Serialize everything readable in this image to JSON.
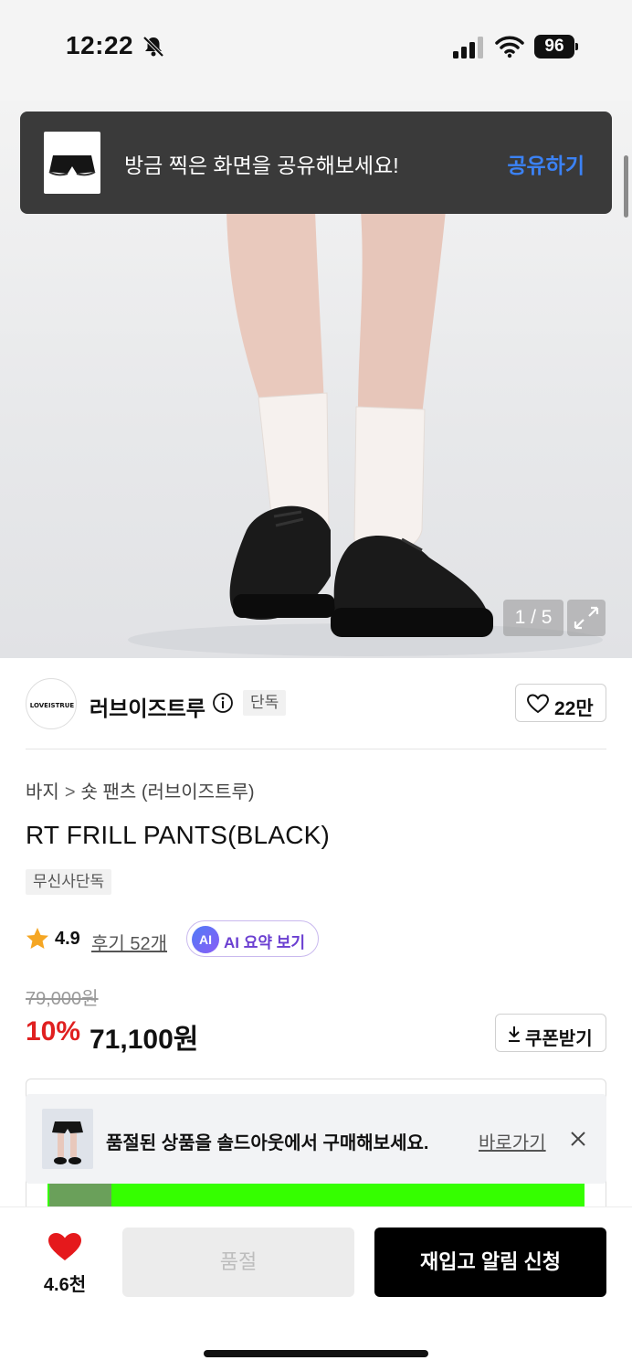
{
  "status_bar": {
    "time": "12:22",
    "battery": "96"
  },
  "share_toast": {
    "message": "방금 찍은 화면을 공유해보세요!",
    "action": "공유하기"
  },
  "gallery": {
    "counter": "1 / 5"
  },
  "brand": {
    "name": "러브이즈트루",
    "badge": "단독",
    "likes": "22만",
    "logo_text": "LOVEISTRUE"
  },
  "product": {
    "breadcrumb": {
      "category": "바지",
      "separator": ">",
      "subcategory": "숏 팬츠 (러브이즈트루)"
    },
    "title": "RT FRILL PANTS(BLACK)",
    "tag": "무신사단독",
    "rating": "4.9",
    "reviews": "후기 52개",
    "ai_summary": {
      "icon_text": "AI",
      "label": "AI 요약 보기"
    },
    "original_price": "79,000원",
    "discount": "10%",
    "price": "71,100원",
    "coupon_label": "쿠폰받기"
  },
  "soldout_toast": {
    "message": "품절된 상품을 솔드아웃에서 구매해보세요.",
    "link": "바로가기"
  },
  "bottom_bar": {
    "fav_count": "4.6천",
    "soldout_label": "품절",
    "restock_label": "재입고 알림 신청"
  },
  "colors": {
    "accent_red": "#e02020",
    "link_blue": "#3b82f6",
    "ai_purple": "#6b3fd1",
    "banner_green": "#35ff00"
  }
}
